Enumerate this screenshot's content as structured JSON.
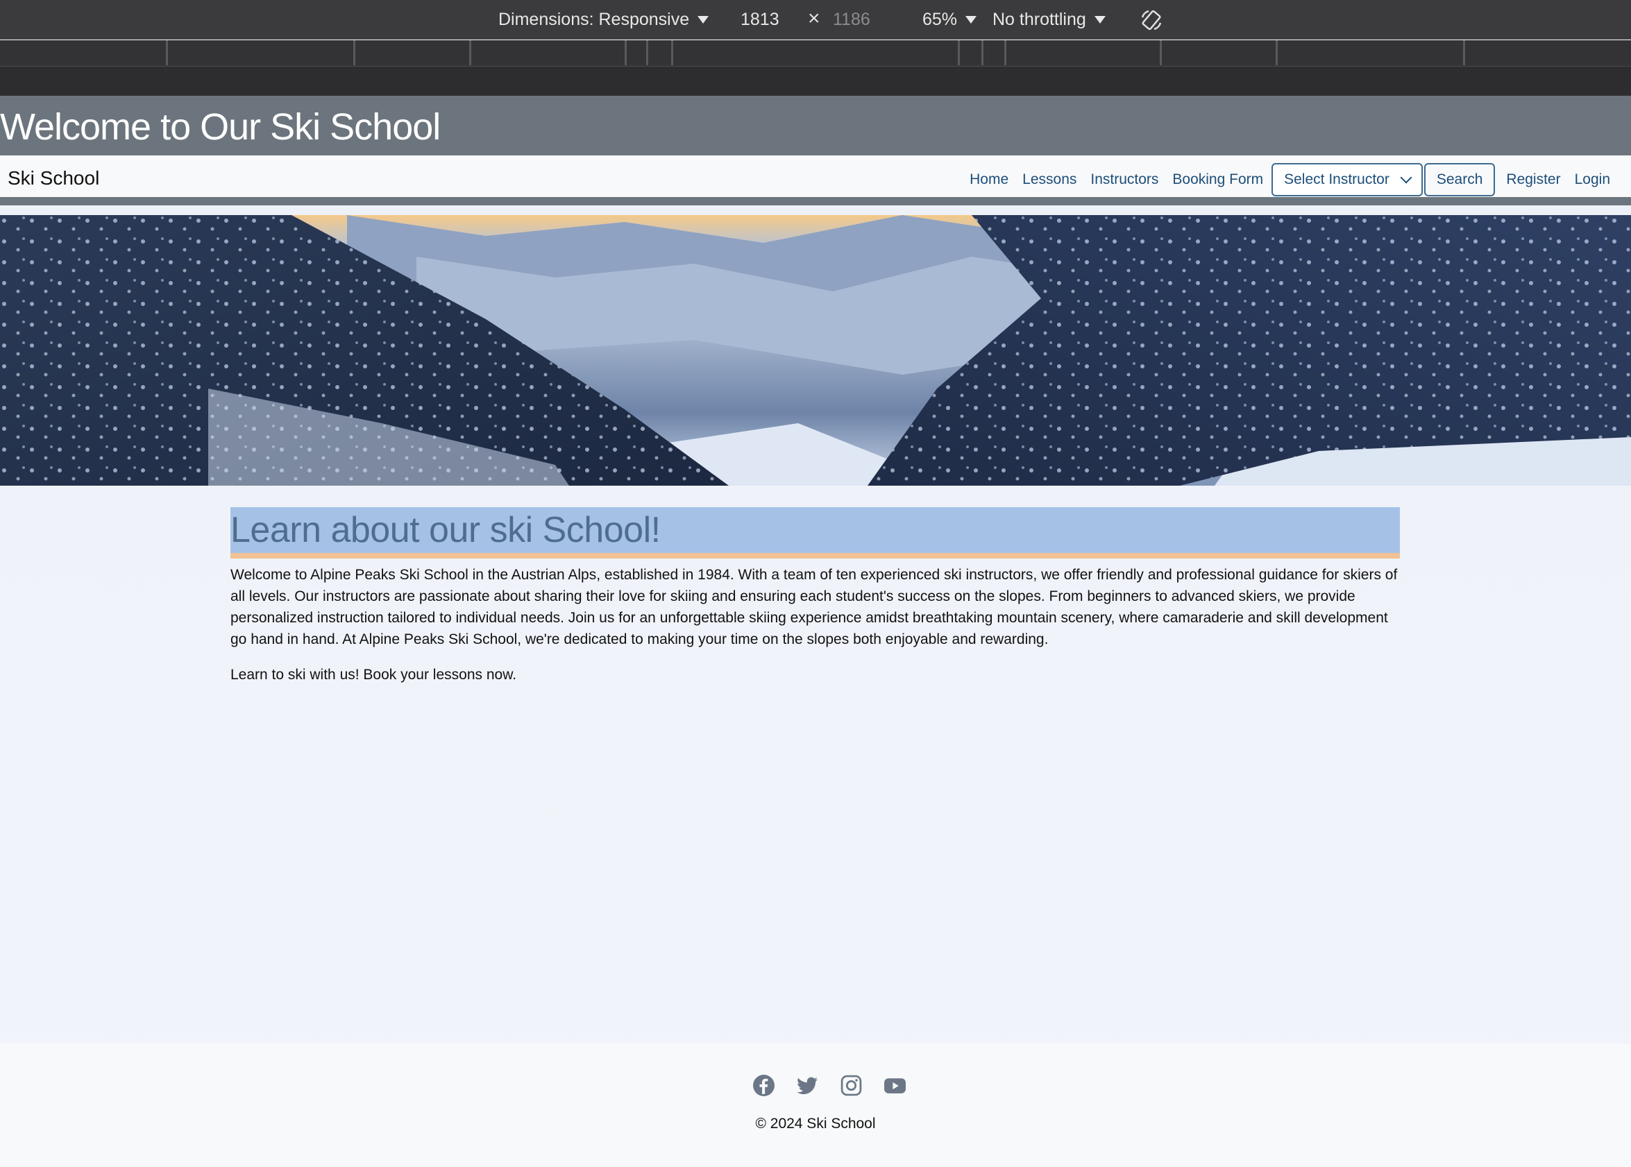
{
  "devtools": {
    "dimensions_label": "Dimensions: Responsive",
    "width": "1813",
    "times": "×",
    "height": "1186",
    "zoom": "65%",
    "throttling": "No throttling",
    "rotate_icon": "rotate-icon"
  },
  "header": {
    "title": "Welcome to Our Ski School"
  },
  "navbar": {
    "brand": "Ski School",
    "links": [
      "Home",
      "Lessons",
      "Instructors",
      "Booking Form"
    ],
    "select_label": "Select Instructor",
    "search_label": "Search",
    "register_label": "Register",
    "login_label": "Login"
  },
  "hero": {
    "image": "snowy-valley-landscape"
  },
  "main": {
    "heading": "Learn about our ski School!",
    "intro": "Welcome to Alpine Peaks Ski School in the Austrian Alps, established in 1984. With a team of ten experienced ski instructors, we offer friendly and professional guidance for skiers of all levels. Our instructors are passionate about sharing their love for skiing and ensuring each student's success on the slopes. From beginners to advanced skiers, we provide personalized instruction tailored to individual needs. Join us for an unforgettable skiing experience amidst breathtaking mountain scenery, where camaraderie and skill development go hand in hand. At Alpine Peaks Ski School, we're dedicated to making your time on the slopes both enjoyable and rewarding.",
    "cta": "Learn to ski with us! Book your lessons now."
  },
  "footer": {
    "social_icons": [
      "facebook-icon",
      "twitter-icon",
      "instagram-icon",
      "youtube-icon"
    ],
    "copyright": "© 2024 Ski School"
  },
  "colors": {
    "header_bg": "#6c757d",
    "heading_bg": "#a5c2e6",
    "heading_underline": "#f2c195",
    "link": "#1d4e7a"
  }
}
